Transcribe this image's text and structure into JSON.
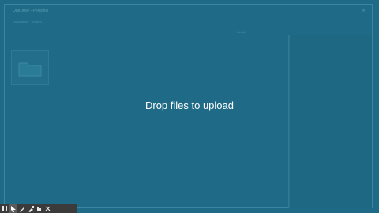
{
  "header": {
    "title": "OneDrive - Personal",
    "close_glyph": "×"
  },
  "breadcrumb": "Documents · Shared",
  "right_header_label": "Details",
  "overlay": {
    "message": "Drop files to upload"
  },
  "taskbar": {
    "tools": [
      {
        "icon": "pause-icon",
        "glyph": "⏸"
      },
      {
        "icon": "pointer-icon",
        "glyph": "➤"
      },
      {
        "icon": "pen-icon",
        "glyph": "✎"
      },
      {
        "icon": "highlighter-icon",
        "glyph": "✐"
      },
      {
        "icon": "eraser-icon",
        "glyph": "▰"
      },
      {
        "icon": "close-icon",
        "glyph": "✕"
      }
    ]
  },
  "colors": {
    "overlay": "#1f6b87",
    "taskbar": "#3b3b3b",
    "text": "#ffffff"
  }
}
